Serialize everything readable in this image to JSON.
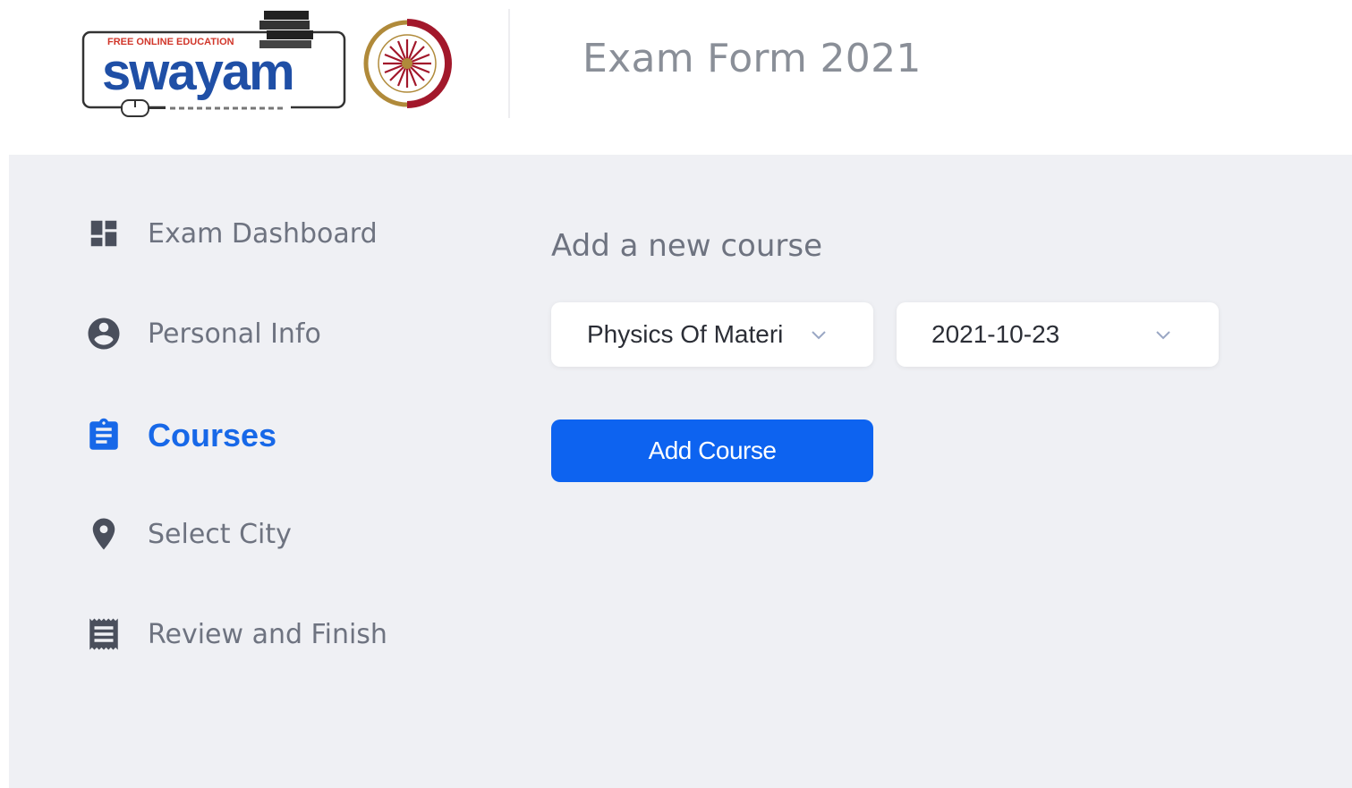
{
  "header": {
    "logo_tagline": "FREE ONLINE EDUCATION",
    "logo_text": "swayam",
    "title": "Exam Form 2021"
  },
  "sidebar": {
    "items": [
      {
        "label": "Exam Dashboard",
        "icon": "dashboard-icon",
        "active": false
      },
      {
        "label": "Personal Info",
        "icon": "account-circle-icon",
        "active": false
      },
      {
        "label": "Courses",
        "icon": "clipboard-icon",
        "active": true
      },
      {
        "label": "Select City",
        "icon": "location-pin-icon",
        "active": false
      },
      {
        "label": "Review and Finish",
        "icon": "receipt-icon",
        "active": false
      }
    ]
  },
  "main": {
    "section_title": "Add a new course",
    "course_select": {
      "value": "Physics Of Materi"
    },
    "date_select": {
      "value": "2021-10-23"
    },
    "add_button_label": "Add Course"
  },
  "colors": {
    "accent": "#1768e8",
    "button": "#0d63f0",
    "background": "#eff0f4",
    "muted_text": "#6e7380"
  }
}
